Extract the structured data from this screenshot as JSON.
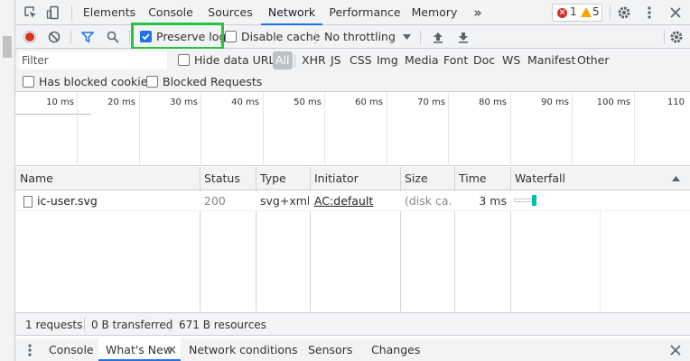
{
  "main_tabs": [
    {
      "label": "Elements"
    },
    {
      "label": "Console"
    },
    {
      "label": "Sources"
    },
    {
      "label": "Network"
    },
    {
      "label": "Performance"
    },
    {
      "label": "Memory"
    }
  ],
  "more_tabs_glyph": "»",
  "counts": {
    "errors": "1",
    "warnings": "5"
  },
  "toolbar": {
    "preserve_log_label": "Preserve log",
    "preserve_log_checked": true,
    "disable_cache_label": "Disable cache",
    "disable_cache_checked": false,
    "throttling_value": "No throttling"
  },
  "filter": {
    "placeholder": "Filter",
    "hide_data_urls_label": "Hide data URLs",
    "types": [
      "All",
      "XHR",
      "JS",
      "CSS",
      "Img",
      "Media",
      "Font",
      "Doc",
      "WS",
      "Manifest",
      "Other"
    ],
    "active_type": "All",
    "has_blocked_cookies_label": "Has blocked cookies",
    "blocked_requests_label": "Blocked Requests"
  },
  "overview": {
    "ticks": [
      "10 ms",
      "20 ms",
      "30 ms",
      "40 ms",
      "50 ms",
      "60 ms",
      "70 ms",
      "80 ms",
      "90 ms",
      "100 ms",
      "110"
    ]
  },
  "table": {
    "columns": [
      "Name",
      "Status",
      "Type",
      "Initiator",
      "Size",
      "Time",
      "Waterfall"
    ],
    "rows": [
      {
        "name": "ic-user.svg",
        "status": "200",
        "type": "svg+xml",
        "initiator": "AC:default",
        "size": "(disk ca...",
        "time": "3 ms"
      }
    ]
  },
  "summary": {
    "requests": "1 requests",
    "transferred": "0 B transferred",
    "resources": "671 B resources"
  },
  "drawer_tabs": [
    {
      "label": "Console"
    },
    {
      "label": "What's New"
    },
    {
      "label": "Network conditions"
    },
    {
      "label": "Sensors"
    },
    {
      "label": "Changes"
    }
  ],
  "colors": {
    "accent": "#1a73e8",
    "record": "#d93025",
    "highlight_box": "#29c43e",
    "waterfall_bar": "#00bfa5"
  }
}
